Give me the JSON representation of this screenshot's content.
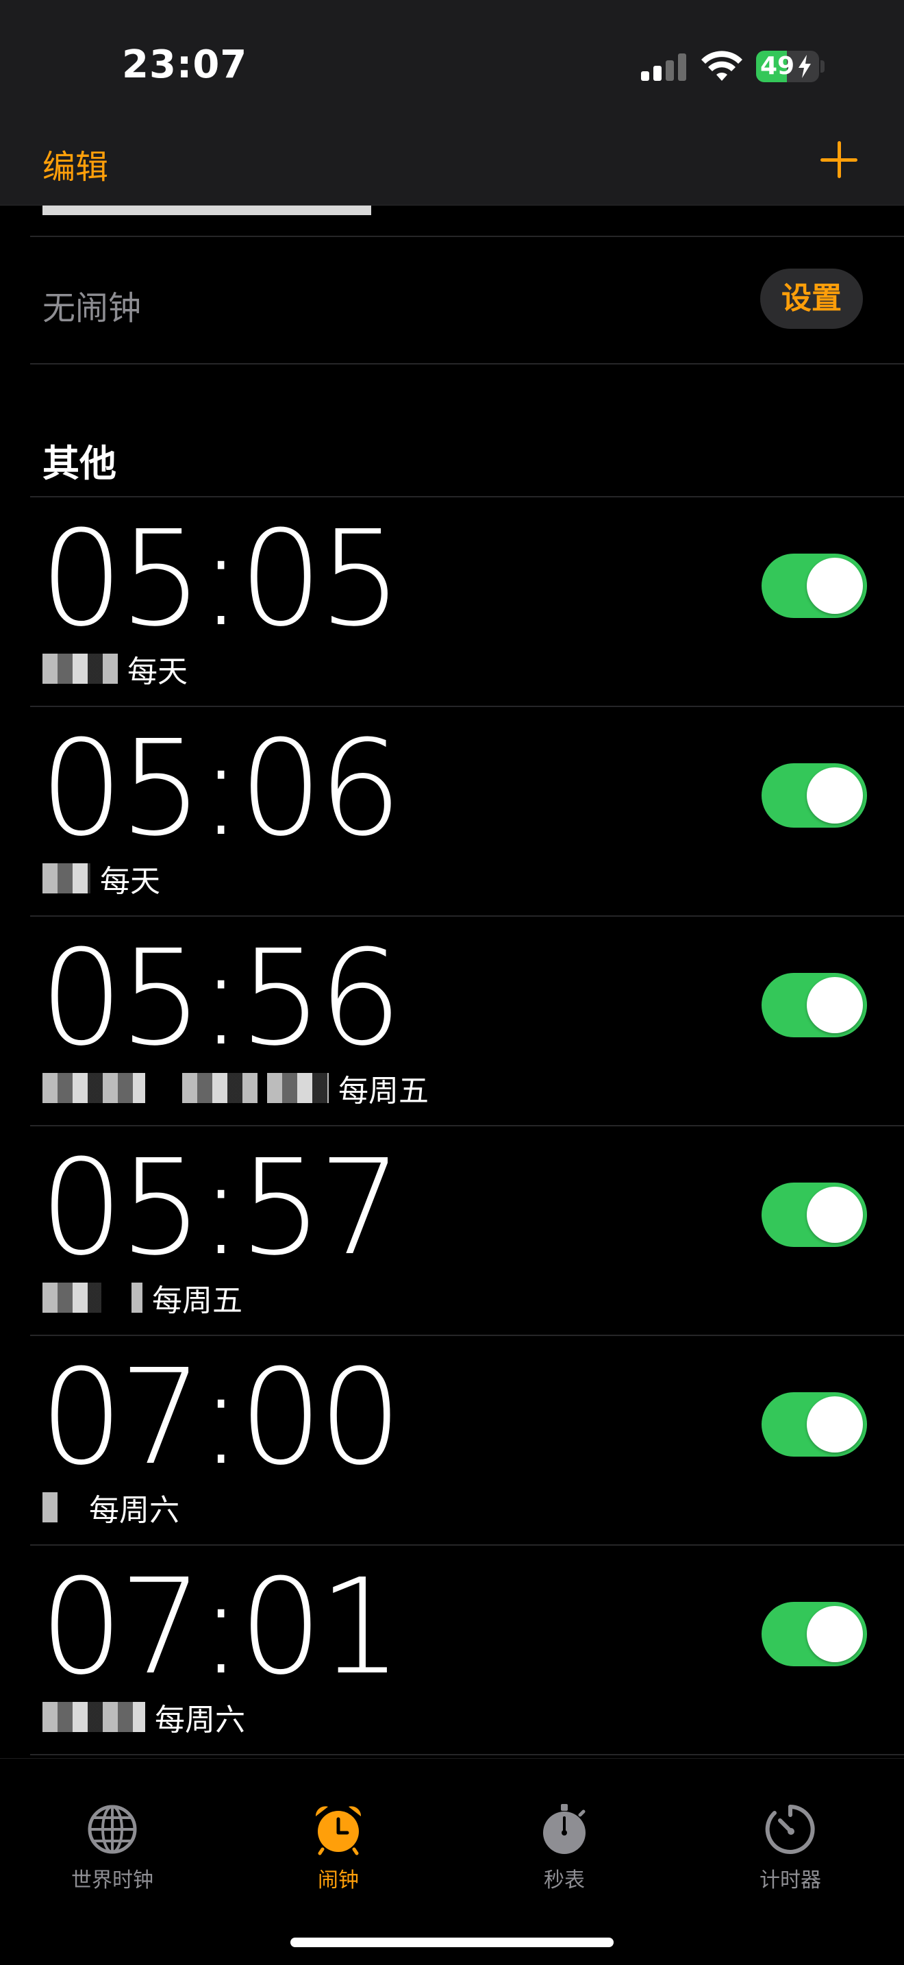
{
  "status": {
    "time": "23:07",
    "battery": "49",
    "battery_level": 0.49
  },
  "nav": {
    "edit_label": "编辑",
    "add_icon": "plus-icon"
  },
  "sleep": {
    "no_alarm": "无闹钟",
    "setup_label": "设置"
  },
  "section": {
    "title": "其他"
  },
  "alarms": [
    {
      "time": "05:05",
      "repeat": "每天",
      "enabled": true
    },
    {
      "time": "05:06",
      "repeat": "每天",
      "enabled": true
    },
    {
      "time": "05:56",
      "repeat": "每周五",
      "enabled": true
    },
    {
      "time": "05:57",
      "repeat": "每周五",
      "enabled": true
    },
    {
      "time": "07:00",
      "repeat": "每周六",
      "enabled": true
    },
    {
      "time": "07:01",
      "repeat": "每周六",
      "enabled": true
    }
  ],
  "tabs": [
    {
      "label": "世界时钟",
      "icon": "globe-icon",
      "active": false
    },
    {
      "label": "闹钟",
      "icon": "alarm-clock-icon",
      "active": true
    },
    {
      "label": "秒表",
      "icon": "stopwatch-icon",
      "active": false
    },
    {
      "label": "计时器",
      "icon": "timer-icon",
      "active": false
    }
  ],
  "colors": {
    "accent": "#ff9f0a",
    "toggle_on": "#34c759",
    "secondary_text": "#8e8e93"
  }
}
